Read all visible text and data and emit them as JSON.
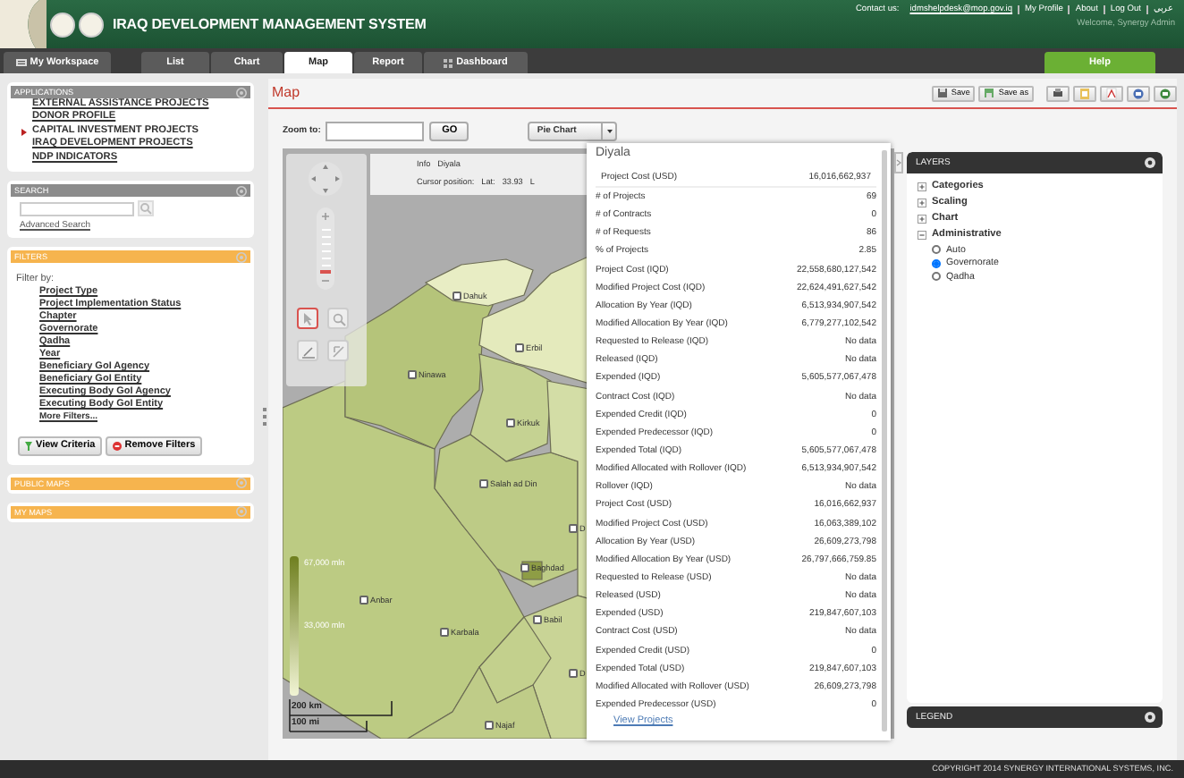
{
  "header": {
    "title": "IRAQ DEVELOPMENT MANAGEMENT SYSTEM",
    "contact_label": "Contact us:",
    "contact_email": "idmshelpdesk@mop.gov.iq",
    "links": [
      "My Profile",
      "About",
      "Log Out",
      "عربي"
    ],
    "welcome": "Welcome,  Synergy Admin"
  },
  "tabs": [
    {
      "label": "My Workspace",
      "kind": "workspace",
      "selected": false
    },
    {
      "label": "List",
      "kind": "plain",
      "selected": false
    },
    {
      "label": "Chart",
      "kind": "plain",
      "selected": false
    },
    {
      "label": "Map",
      "kind": "plain",
      "selected": true
    },
    {
      "label": "Report",
      "kind": "plain",
      "selected": false
    },
    {
      "label": "Dashboard",
      "kind": "dashboard",
      "selected": false
    }
  ],
  "help": "Help",
  "sidebar": [
    {
      "kind": "applications",
      "title": "APPLICATIONS",
      "items": [
        {
          "label": "EXTERNAL ASSISTANCE PROJECTS",
          "selected": false
        },
        {
          "label": "DONOR PROFILE",
          "selected": false
        },
        {
          "label": "CAPITAL INVESTMENT PROJECTS",
          "selected": true
        },
        {
          "label": "IRAQ DEVELOPMENT PROJECTS",
          "selected": false
        },
        {
          "label": "NDP INDICATORS",
          "selected": false
        }
      ]
    },
    {
      "kind": "search",
      "title": "SEARCH",
      "link": "Advanced Search"
    },
    {
      "kind": "filters",
      "title": "FILTERS",
      "intro": "Filter by:",
      "links": [
        "Project Type",
        "Project Implementation Status",
        "Chapter",
        "Governorate",
        "Qadha",
        "Year",
        "Beneficiary GoI Agency",
        "Beneficiary GoI Entity",
        "Executing Body GoI Agency",
        "Executing Body GoI Entity"
      ],
      "more": "More Filters...",
      "buttons": [
        "View Criteria",
        "Remove Filters"
      ]
    },
    {
      "kind": "collapsed",
      "title": "PUBLIC MAPS"
    },
    {
      "kind": "collapsed",
      "title": "MY MAPS"
    }
  ],
  "main": {
    "title": "Map",
    "toolbar": [
      {
        "kind": "save",
        "label": "Save"
      },
      {
        "kind": "save_as",
        "label": "Save as"
      },
      {
        "kind": "print"
      },
      {
        "kind": "clipboard"
      },
      {
        "kind": "pdf"
      },
      {
        "kind": "document"
      },
      {
        "kind": "spreadsheet"
      }
    ],
    "zoom_label": "Zoom to:",
    "go": "GO",
    "chart_select": "Pie Chart"
  },
  "map": {
    "info_label": "Info",
    "info_value": "Diyala",
    "cursor_label": "Cursor position:",
    "lat_label": "Lat:",
    "lat_value": "33.93",
    "cut_text": "L",
    "zoom_slider": {
      "level": 0.2
    },
    "tools": [
      {
        "kind": "pointer",
        "selected": true
      },
      {
        "kind": "zoom",
        "selected": false
      },
      {
        "kind": "pencil",
        "selected": false
      },
      {
        "kind": "measure",
        "selected": false
      }
    ],
    "regions": [
      "Dahuk",
      "Erbil",
      "Ninawa",
      "Kirkuk",
      "Salah ad Din",
      "D",
      "Baghdad",
      "Anbar",
      "Babil",
      "Karbala",
      "D",
      "Najaf"
    ],
    "legend": [
      "67,000 mln",
      "33,000 mln"
    ],
    "scale": [
      "200 km",
      "100 mi"
    ]
  },
  "popup": {
    "title": "Diyala",
    "header_row": {
      "label": "Project Cost (USD)",
      "value": "16,016,662,937"
    },
    "rows": [
      {
        "label": "# of Projects",
        "value": "69"
      },
      {
        "label": "# of Contracts",
        "value": "0"
      },
      {
        "label": "# of Requests",
        "value": "86"
      },
      {
        "label": "% of Projects",
        "value": "2.85"
      },
      {
        "label": "Project Cost (IQD)",
        "value": "22,558,680,127,542"
      },
      {
        "label": "Modified Project Cost (IQD)",
        "value": "22,624,491,627,542"
      },
      {
        "label": "Allocation By Year (IQD)",
        "value": "6,513,934,907,542"
      },
      {
        "label": "Modified Allocation By Year (IQD)",
        "value": "6,779,277,102,542"
      },
      {
        "label": "Requested to Release (IQD)",
        "value": "No data"
      },
      {
        "label": "Released (IQD)",
        "value": "No data"
      },
      {
        "label": "Expended (IQD)",
        "value": "5,605,577,067,478"
      },
      {
        "label": "Contract Cost (IQD)",
        "value": "No data"
      },
      {
        "label": "Expended Credit (IQD)",
        "value": "0"
      },
      {
        "label": "Expended Predecessor (IQD)",
        "value": "0"
      },
      {
        "label": "Expended Total (IQD)",
        "value": "5,605,577,067,478"
      },
      {
        "label": "Modified Allocated with Rollover (IQD)",
        "value": "6,513,934,907,542"
      },
      {
        "label": "Rollover (IQD)",
        "value": "No data"
      },
      {
        "label": "Project Cost (USD)",
        "value": "16,016,662,937"
      },
      {
        "label": "Modified Project Cost (USD)",
        "value": "16,063,389,102"
      },
      {
        "label": "Allocation By Year (USD)",
        "value": "26,609,273,798"
      },
      {
        "label": "Modified Allocation By Year (USD)",
        "value": "26,797,666,759.85"
      },
      {
        "label": "Requested to Release (USD)",
        "value": "No data"
      },
      {
        "label": "Released (USD)",
        "value": "No data"
      },
      {
        "label": "Expended (USD)",
        "value": "219,847,607,103"
      },
      {
        "label": "Contract Cost (USD)",
        "value": "No data"
      },
      {
        "label": "Expended Credit (USD)",
        "value": "0"
      },
      {
        "label": "Expended Total (USD)",
        "value": "219,847,607,103"
      },
      {
        "label": "Modified Allocated with Rollover (USD)",
        "value": "26,609,273,798"
      },
      {
        "label": "Expended Predecessor (USD)",
        "value": "0"
      }
    ],
    "link": "View Projects"
  },
  "layers": {
    "title": "LAYERS",
    "items": [
      {
        "label": "Categories",
        "expanded": false
      },
      {
        "label": "Scaling",
        "expanded": false
      },
      {
        "label": "Chart",
        "expanded": false
      },
      {
        "label": "Administrative",
        "expanded": true,
        "children": [
          {
            "label": "Auto",
            "selected": false
          },
          {
            "label": "Governorate",
            "selected": true
          },
          {
            "label": "Qadha",
            "selected": false
          }
        ]
      }
    ]
  },
  "legend_panel": {
    "title": "LEGEND"
  },
  "footer": "COPYRIGHT 2014 SYNERGY INTERNATIONAL SYSTEMS, INC."
}
